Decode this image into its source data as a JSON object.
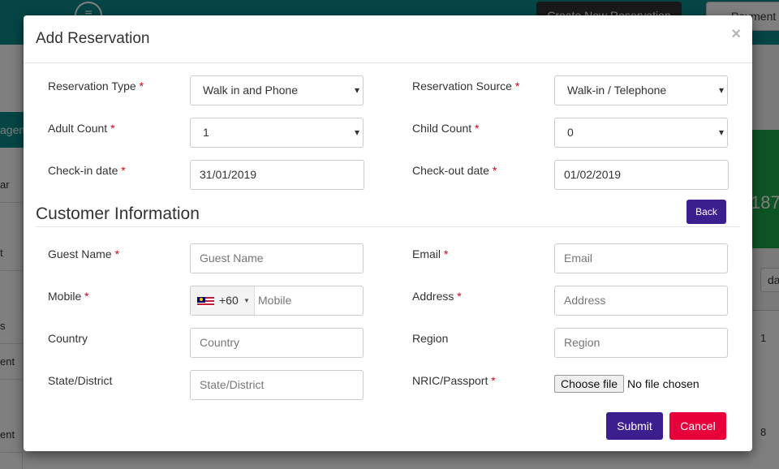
{
  "background": {
    "menu_icon": "hamburger-icon",
    "create_button": "Create New Reservation",
    "payment_button": "Payment",
    "side_tab": "agem",
    "side_rows": [
      "ar",
      "t",
      "s",
      "ent",
      "ent"
    ],
    "card_text": "187.",
    "date_button": "da",
    "grid_numbers": [
      "1",
      "8"
    ]
  },
  "modal": {
    "title": "Add Reservation",
    "close_glyph": "×",
    "required_mark": "*",
    "reservation_type": {
      "label": "Reservation Type",
      "value": "Walk in and Phone"
    },
    "reservation_source": {
      "label": "Reservation Source",
      "value": "Walk-in / Telephone"
    },
    "adult_count": {
      "label": "Adult Count",
      "value": "1"
    },
    "child_count": {
      "label": "Child Count",
      "value": "0"
    },
    "checkin": {
      "label": "Check-in date",
      "value": "31/01/2019"
    },
    "checkout": {
      "label": "Check-out date",
      "value": "01/02/2019"
    },
    "customer_section": {
      "title": "Customer Information",
      "back_label": "Back"
    },
    "guest_name": {
      "label": "Guest Name",
      "placeholder": "Guest Name"
    },
    "email": {
      "label": "Email",
      "placeholder": "Email"
    },
    "mobile": {
      "label": "Mobile",
      "dial_code": "+60",
      "placeholder": "Mobile",
      "flag_icon": "malaysia-flag-icon"
    },
    "address": {
      "label": "Address",
      "placeholder": "Address"
    },
    "country": {
      "label": "Country",
      "placeholder": "Country"
    },
    "region": {
      "label": "Region",
      "placeholder": "Region"
    },
    "state": {
      "label": "State/District",
      "placeholder": "State/District"
    },
    "nric": {
      "label": "NRIC/Passport",
      "file_button": "Choose file",
      "file_status": "No file chosen"
    },
    "submit_label": "Submit",
    "cancel_label": "Cancel"
  },
  "colors": {
    "primary": "#3c1f8f",
    "danger": "#e8003a",
    "required": "#d9001b",
    "topbar": "#0a8a8c"
  }
}
